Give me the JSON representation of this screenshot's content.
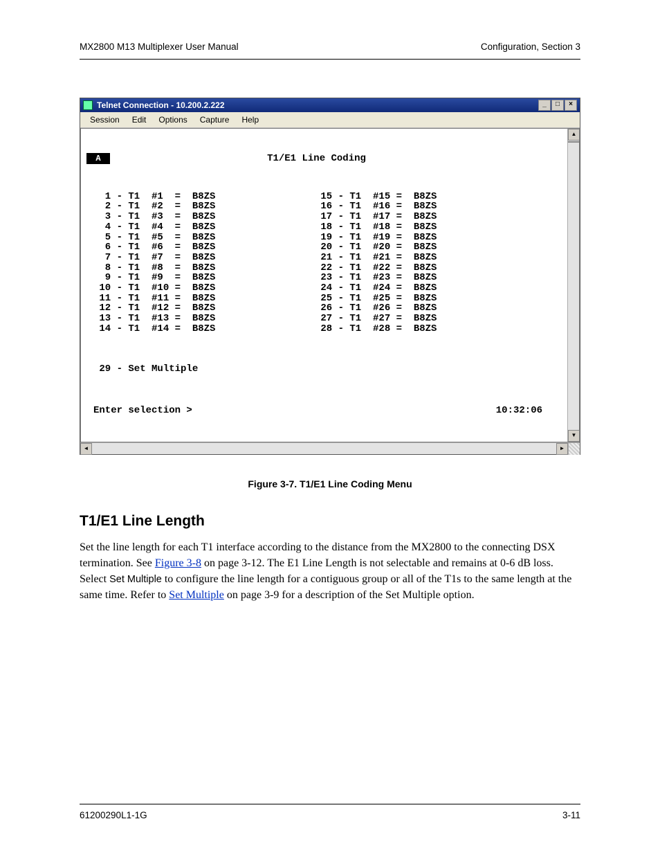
{
  "running_head": {
    "left": "MX2800 M13 Multiplexer User Manual",
    "right": "Configuration, Section 3"
  },
  "window": {
    "title": "Telnet Connection - 10.200.2.222",
    "controls": {
      "min": "_",
      "max": "□",
      "close": "×"
    },
    "menu": [
      "Session",
      "Edit",
      "Options",
      "Capture",
      "Help"
    ]
  },
  "terminal": {
    "indicator": "A",
    "title": "T1/E1 Line Coding",
    "left_lines": [
      "  1 - T1  #1  =  B8ZS",
      "  2 - T1  #2  =  B8ZS",
      "  3 - T1  #3  =  B8ZS",
      "  4 - T1  #4  =  B8ZS",
      "  5 - T1  #5  =  B8ZS",
      "  6 - T1  #6  =  B8ZS",
      "  7 - T1  #7  =  B8ZS",
      "  8 - T1  #8  =  B8ZS",
      "  9 - T1  #9  =  B8ZS",
      " 10 - T1  #10 =  B8ZS",
      " 11 - T1  #11 =  B8ZS",
      " 12 - T1  #12 =  B8ZS",
      " 13 - T1  #13 =  B8ZS",
      " 14 - T1  #14 =  B8ZS"
    ],
    "right_lines": [
      " 15 - T1  #15 =  B8ZS",
      " 16 - T1  #16 =  B8ZS",
      " 17 - T1  #17 =  B8ZS",
      " 18 - T1  #18 =  B8ZS",
      " 19 - T1  #19 =  B8ZS",
      " 20 - T1  #20 =  B8ZS",
      " 21 - T1  #21 =  B8ZS",
      " 22 - T1  #22 =  B8ZS",
      " 23 - T1  #23 =  B8ZS",
      " 24 - T1  #24 =  B8ZS",
      " 25 - T1  #25 =  B8ZS",
      " 26 - T1  #26 =  B8ZS",
      " 27 - T1  #27 =  B8ZS",
      " 28 - T1  #28 =  B8ZS"
    ],
    "option29": " 29 - Set Multiple",
    "prompt": "Enter selection >",
    "clock": "10:32:06"
  },
  "figure_caption": "Figure 3-7.  T1/E1 Line Coding Menu",
  "section_heading": "T1/E1 Line Length",
  "body": {
    "p1a": "Set the line length for each T1 interface according to the distance from the MX2800 to the connecting DSX termination. See ",
    "link1": "Figure 3-8",
    "p1b": " on page 3-12. The E1 Line Length is not selectable and remains at 0-6 dB loss. Select ",
    "sans1": "Set Multiple",
    "p1c": " to configure the line length for a contiguous group or all of the T1s to the same length at the same time. Refer to ",
    "link2": "Set Multiple",
    "p1d": " on page 3-9 for a description of the Set Multiple option."
  },
  "footer": {
    "left": "61200290L1-1G",
    "right": "3-11"
  }
}
